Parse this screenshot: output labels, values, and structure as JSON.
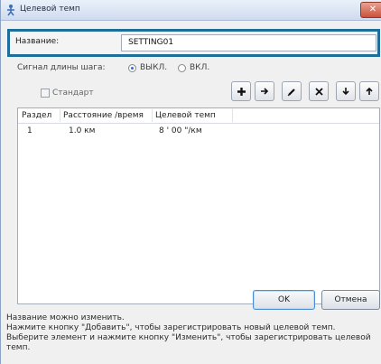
{
  "window": {
    "title": "Целевой темп",
    "close_icon": "close-icon"
  },
  "name_field": {
    "label": "Название:",
    "value": "SETTING01"
  },
  "step_signal": {
    "label": "Сигнал длины шага:",
    "options": [
      {
        "label": "ВЫКЛ.",
        "selected": true
      },
      {
        "label": "ВКЛ.",
        "selected": false
      }
    ]
  },
  "standard_checkbox": {
    "label": "Стандарт",
    "checked": false
  },
  "toolbar": {
    "buttons": [
      "plus-icon",
      "arrow-right-icon",
      "pencil-icon",
      "delete-icon",
      "arrow-down-icon",
      "arrow-up-icon"
    ]
  },
  "table": {
    "columns": [
      "Раздел",
      "Расстояние /время",
      "Целевой темп"
    ],
    "rows": [
      {
        "section": "1",
        "distance": "1.0 км",
        "pace": "8 ' 00 \"/км"
      }
    ]
  },
  "buttons": {
    "ok": "OK",
    "cancel": "Отмена"
  },
  "help": [
    "Название можно изменить.",
    "Нажмите кнопку \"Добавить\", чтобы зарегистрировать новый целевой темп.",
    "Выберите элемент и нажмите кнопку \"Изменить\", чтобы зарегистрировать целевой",
    "темп."
  ],
  "colors": {
    "highlight_border": "#1d6e99",
    "title_bar": "#cfdcee",
    "ok_focus": "#4a8fd3"
  }
}
